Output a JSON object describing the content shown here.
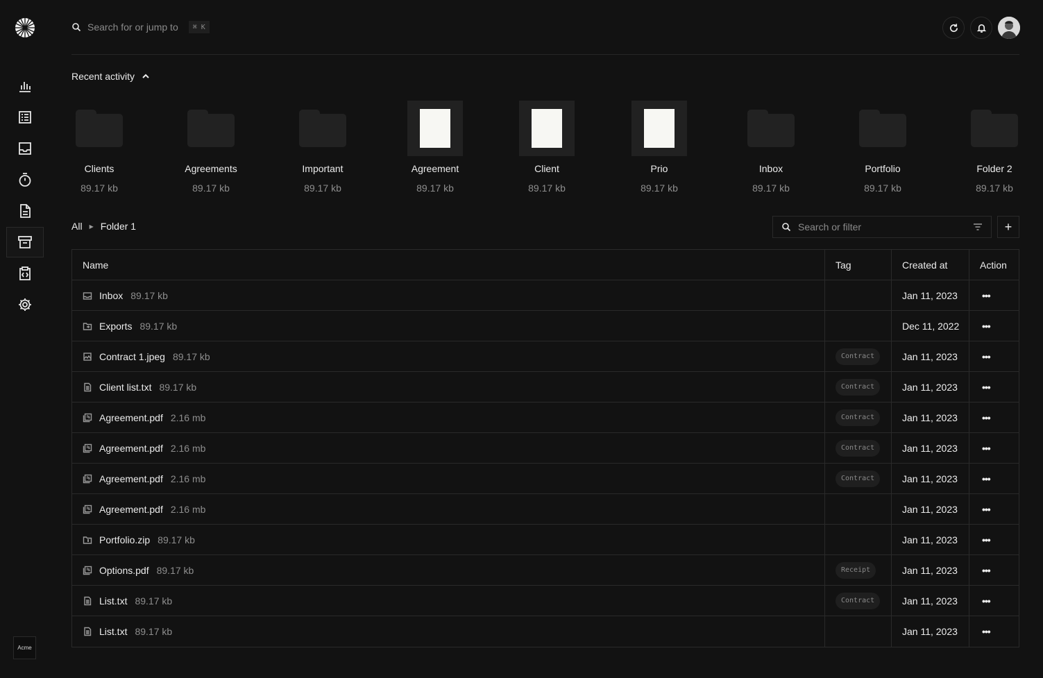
{
  "sidebar": {
    "logo": "aperture-logo-icon",
    "items": [
      {
        "icon": "bar-chart-icon",
        "name": "nav-analytics"
      },
      {
        "icon": "list-icon",
        "name": "nav-transactions"
      },
      {
        "icon": "inbox-icon",
        "name": "nav-inbox"
      },
      {
        "icon": "timer-icon",
        "name": "nav-tracker"
      },
      {
        "icon": "document-icon",
        "name": "nav-invoices"
      },
      {
        "icon": "archive-icon",
        "name": "nav-vault",
        "active": true
      },
      {
        "icon": "code-clipboard-icon",
        "name": "nav-apps"
      },
      {
        "icon": "gear-icon",
        "name": "nav-settings"
      }
    ],
    "team_label": "Acme"
  },
  "header": {
    "search_placeholder": "Search for or jump to",
    "shortcut": "⌘ K"
  },
  "recent": {
    "title": "Recent activity",
    "items": [
      {
        "name": "Clients",
        "size": "89.17 kb",
        "kind": "folder"
      },
      {
        "name": "Agreements",
        "size": "89.17 kb",
        "kind": "folder"
      },
      {
        "name": "Important",
        "size": "89.17 kb",
        "kind": "folder"
      },
      {
        "name": "Agreement",
        "size": "89.17 kb",
        "kind": "document"
      },
      {
        "name": "Client",
        "size": "89.17 kb",
        "kind": "document"
      },
      {
        "name": "Prio",
        "size": "89.17 kb",
        "kind": "document"
      },
      {
        "name": "Inbox",
        "size": "89.17 kb",
        "kind": "folder"
      },
      {
        "name": "Portfolio",
        "size": "89.17 kb",
        "kind": "folder"
      },
      {
        "name": "Folder 2",
        "size": "89.17 kb",
        "kind": "folder"
      }
    ]
  },
  "breadcrumb": {
    "root": "All",
    "current": "Folder 1"
  },
  "filter": {
    "placeholder": "Search or filter",
    "add_label": "+"
  },
  "table": {
    "headers": {
      "name": "Name",
      "tag": "Tag",
      "created": "Created at",
      "action": "Action"
    },
    "action_label": "•••",
    "rows": [
      {
        "icon": "inbox-folder-icon",
        "name": "Inbox",
        "size": "89.17 kb",
        "tag": "",
        "created": "Jan 11, 2023"
      },
      {
        "icon": "export-folder-icon",
        "name": "Exports",
        "size": "89.17 kb",
        "tag": "",
        "created": "Dec 11, 2022"
      },
      {
        "icon": "image-file-icon",
        "name": "Contract 1.jpeg",
        "size": "89.17 kb",
        "tag": "Contract",
        "created": "Jan 11, 2023"
      },
      {
        "icon": "text-file-icon",
        "name": "Client list.txt",
        "size": "89.17 kb",
        "tag": "Contract",
        "created": "Jan 11, 2023"
      },
      {
        "icon": "pdf-file-icon",
        "name": "Agreement.pdf",
        "size": "2.16 mb",
        "tag": "Contract",
        "created": "Jan 11, 2023"
      },
      {
        "icon": "pdf-file-icon",
        "name": "Agreement.pdf",
        "size": "2.16 mb",
        "tag": "Contract",
        "created": "Jan 11, 2023"
      },
      {
        "icon": "pdf-file-icon",
        "name": "Agreement.pdf",
        "size": "2.16 mb",
        "tag": "Contract",
        "created": "Jan 11, 2023"
      },
      {
        "icon": "pdf-file-icon",
        "name": "Agreement.pdf",
        "size": "2.16 mb",
        "tag": "",
        "created": "Jan 11, 2023"
      },
      {
        "icon": "zip-file-icon",
        "name": "Portfolio.zip",
        "size": "89.17 kb",
        "tag": "",
        "created": "Jan 11, 2023"
      },
      {
        "icon": "pdf-file-icon",
        "name": "Options.pdf",
        "size": "89.17 kb",
        "tag": "Receipt",
        "created": "Jan 11, 2023"
      },
      {
        "icon": "text-file-icon",
        "name": "List.txt",
        "size": "89.17 kb",
        "tag": "Contract",
        "created": "Jan 11, 2023"
      },
      {
        "icon": "text-file-icon",
        "name": "List.txt",
        "size": "89.17 kb",
        "tag": "",
        "created": "Jan 11, 2023"
      }
    ]
  }
}
